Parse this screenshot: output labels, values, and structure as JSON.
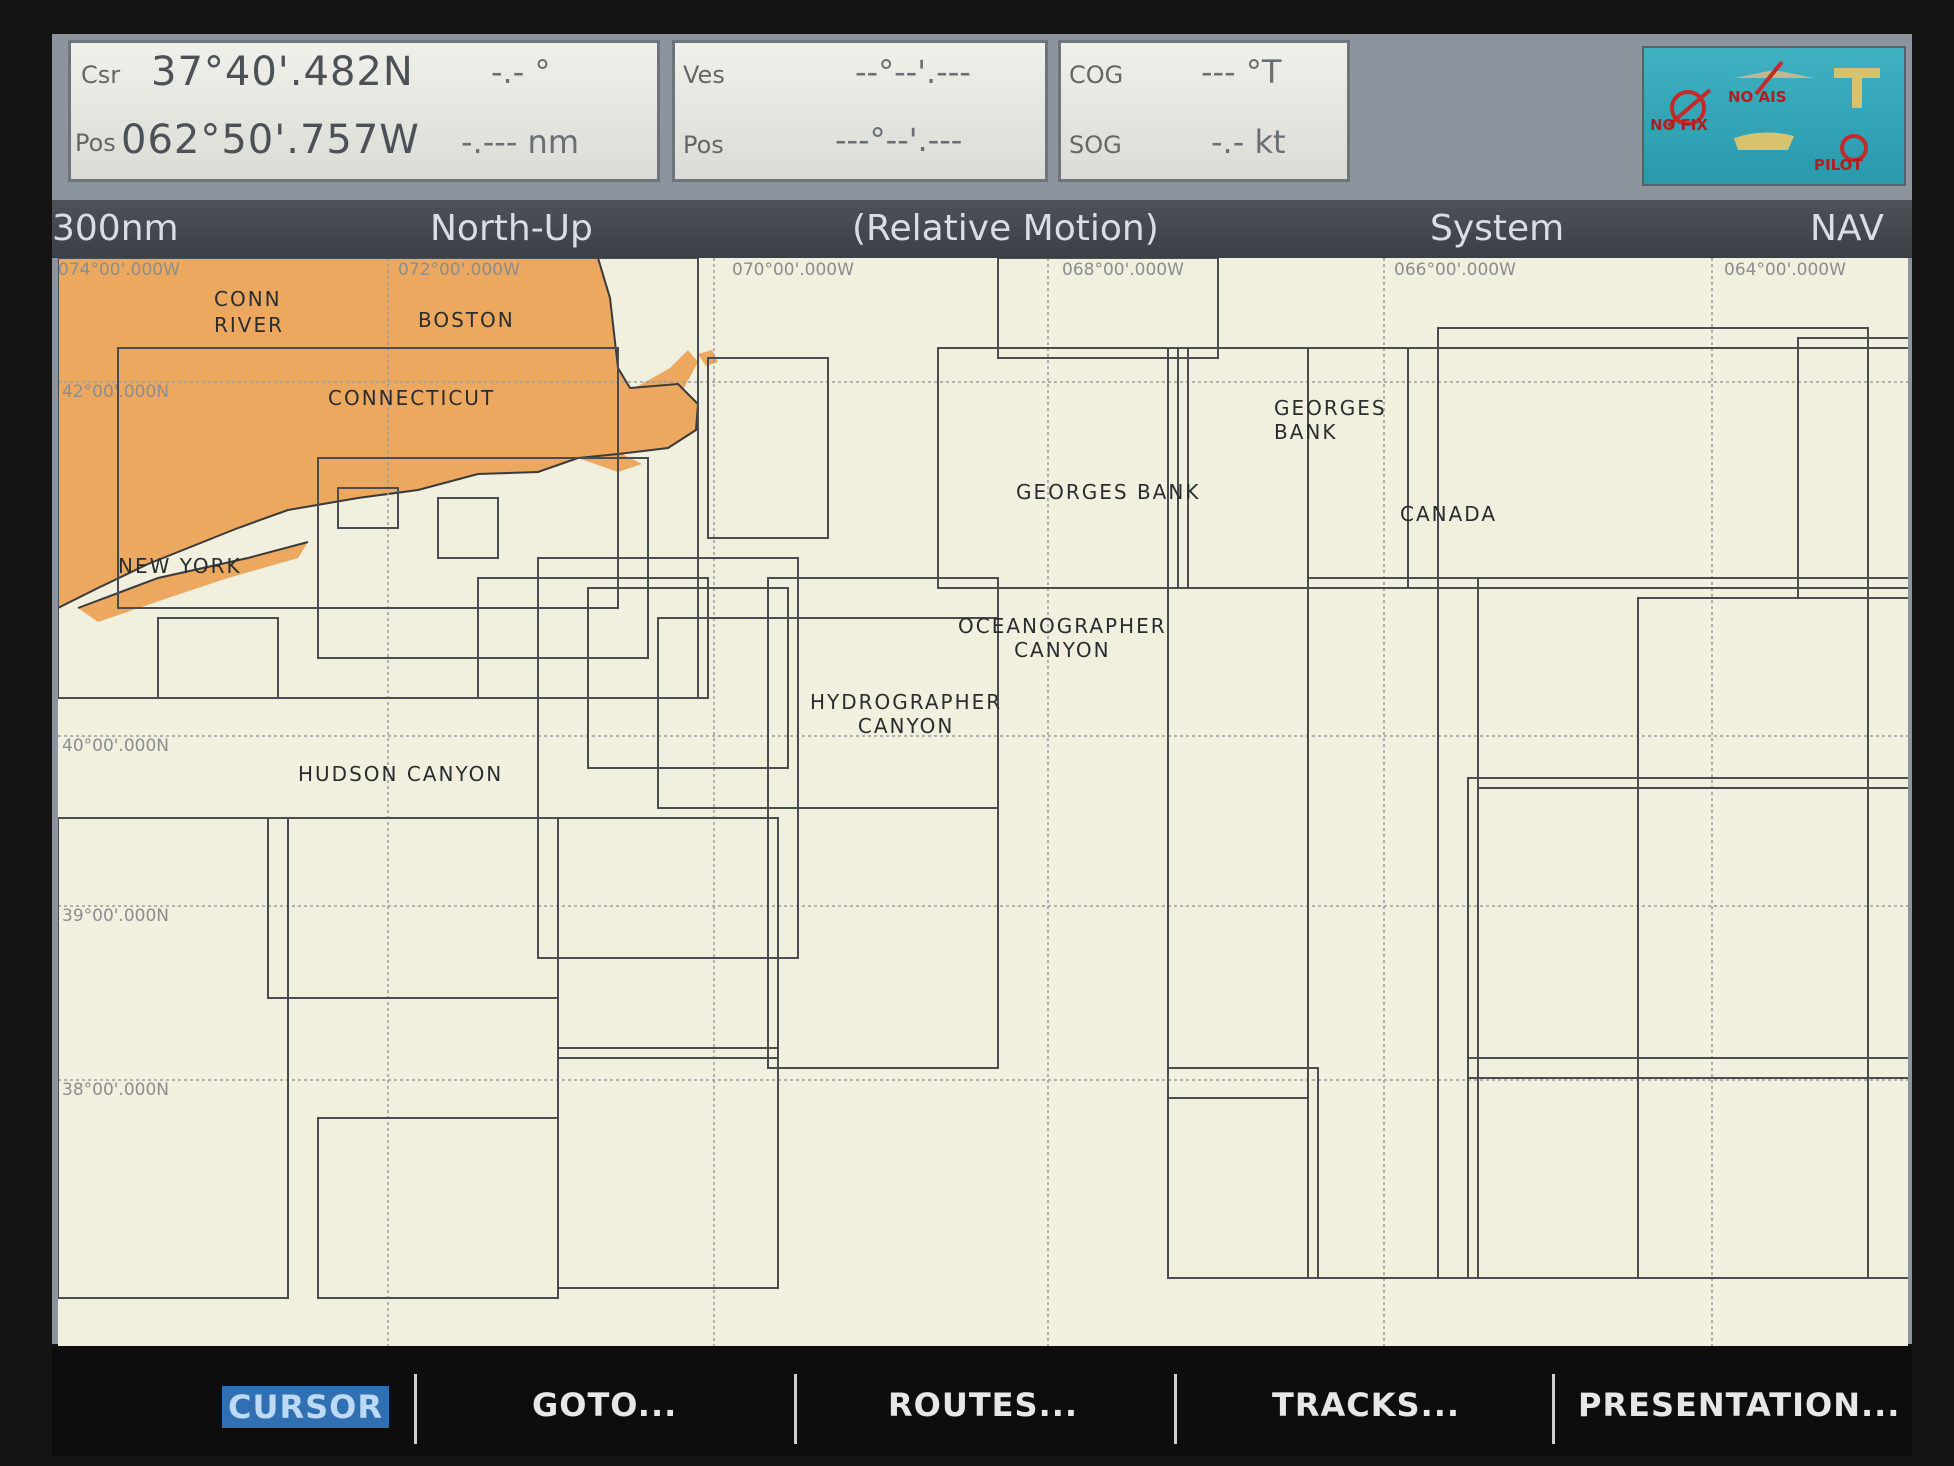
{
  "position_panel": {
    "csr_label": "Csr",
    "latitude": "37°40'.482N",
    "bearing": "-.- °",
    "pos_label": "Pos",
    "longitude": "062°50'.757W",
    "range": "-.--- nm"
  },
  "vessel_panel": {
    "ves_label": "Ves",
    "ves_value": "--°--'.---",
    "pos_label": "Pos",
    "pos_value": "---°--'.---"
  },
  "cog_panel": {
    "cog_label": "COG",
    "cog_value": "--- °T",
    "sog_label": "SOG",
    "sog_value": "-.- kt"
  },
  "status": {
    "nofix": "NO FIX",
    "noais": "NO AIS",
    "pilot": "PILOT"
  },
  "mode_bar": {
    "range": "300nm",
    "orientation": "North-Up",
    "motion": "(Relative Motion)",
    "system": "System",
    "nav": "NAV"
  },
  "chart": {
    "labels": {
      "conn_river": "CONN\nRIVER",
      "boston": "BOSTON",
      "connecticut": "CONNECTICUT",
      "georges_bank_ne": "GEORGES\nBANK",
      "georges_bank": "GEORGES BANK",
      "canada": "CANADA",
      "oceanographer": "OCEANOGRAPHER\nCANYON",
      "hydrographer": "HYDROGRAPHER\nCANYON",
      "hudson": "HUDSON CANYON",
      "new_york": "NEW YORK"
    },
    "grid_labels": {
      "lon_074": "074°00'.000W",
      "lon_072": "072°00'.000W",
      "lon_070": "070°00'.000W",
      "lon_068": "068°00'.000W",
      "lon_066": "066°00'.000W",
      "lon_064": "064°00'.000W",
      "lat_42": "42°00'.000N",
      "lat_40": "40°00'.000N",
      "lat_39": "39°00'.000N",
      "lat_38": "38°00'.000N"
    },
    "colors": {
      "land": "#eca85e",
      "sea": "#f1efde",
      "grid": "#9a9c9e"
    }
  },
  "softkeys": {
    "cursor": "CURSOR",
    "goto": "GOTO...",
    "routes": "ROUTES...",
    "tracks": "TRACKS...",
    "presentation": "PRESENTATION..."
  }
}
